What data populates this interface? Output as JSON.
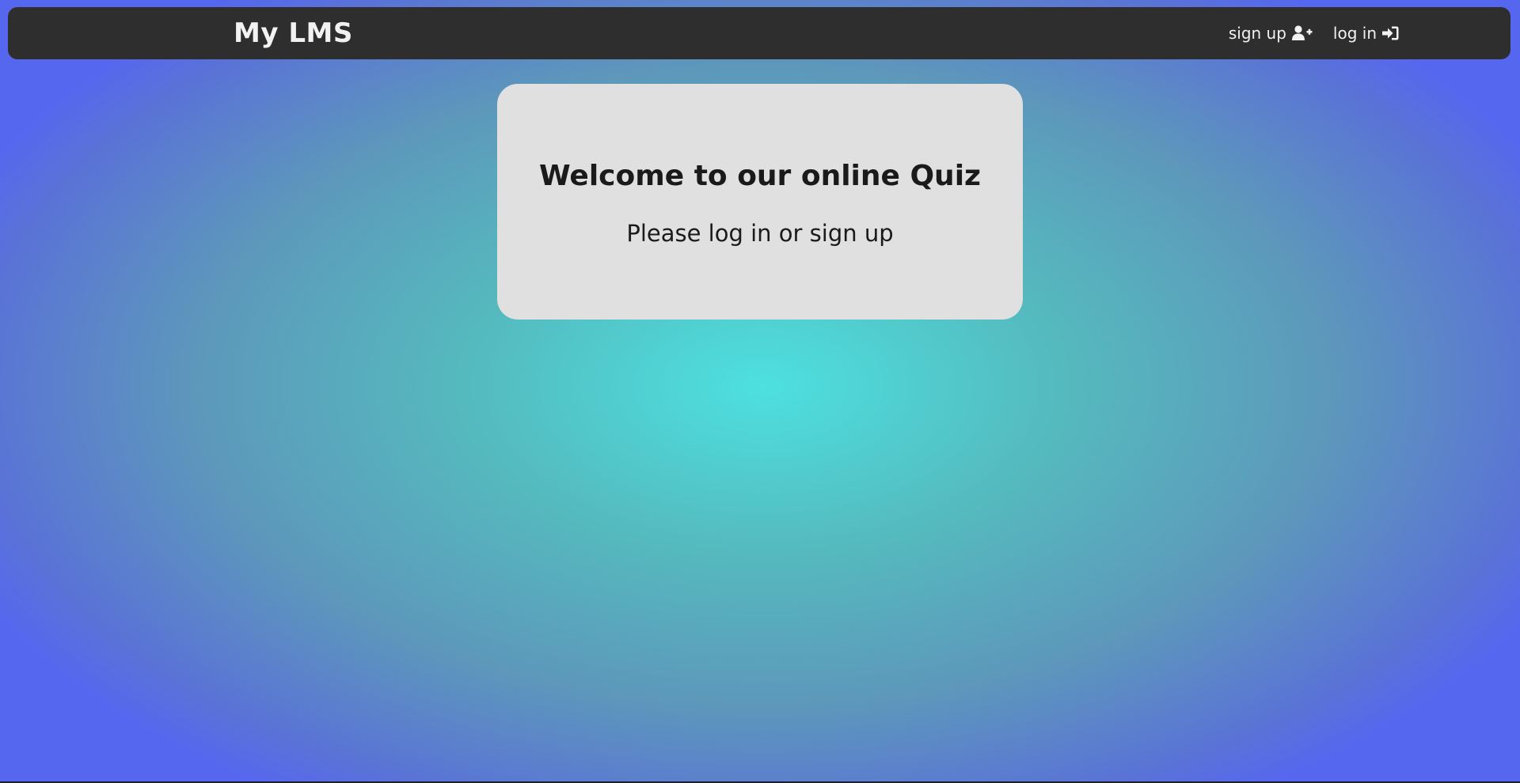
{
  "navbar": {
    "brand": "My LMS",
    "links": [
      {
        "label": "sign up",
        "icon": "user-plus-icon"
      },
      {
        "label": "log in",
        "icon": "sign-in-icon"
      }
    ]
  },
  "welcome_card": {
    "title": "Welcome to our online Quiz",
    "subtitle": "Please log in or sign up"
  },
  "colors": {
    "navbar_bg": "#2e2e2e",
    "card_bg": "#e1e0e1",
    "background_center": "#4de0df",
    "background_edge": "#5567ef"
  }
}
